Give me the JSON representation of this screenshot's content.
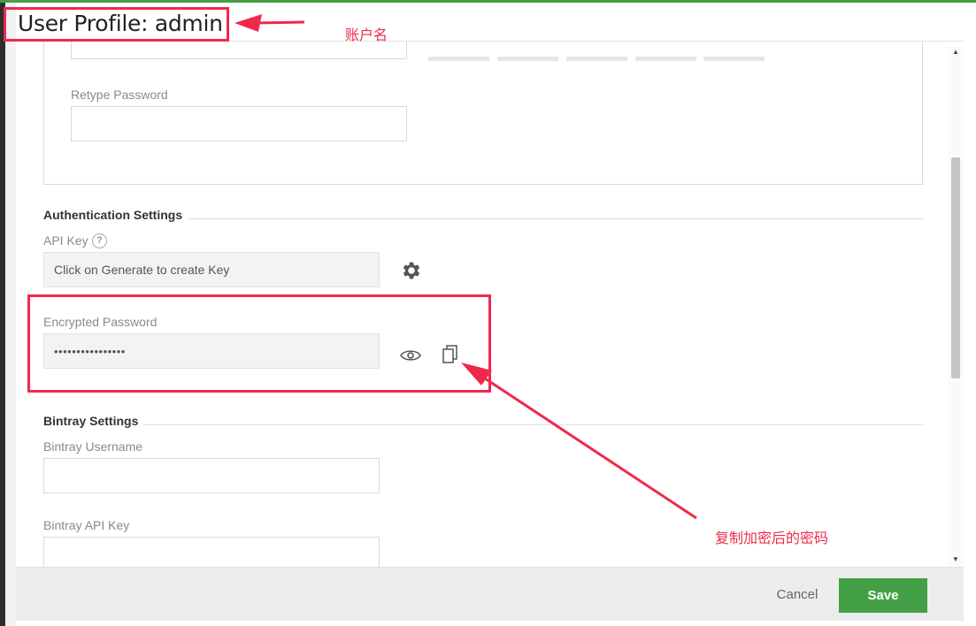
{
  "header": {
    "title": "User Profile: admin"
  },
  "password_section": {
    "retype_label": "Retype Password",
    "retype_value": ""
  },
  "auth": {
    "section_title": "Authentication Settings",
    "api_key_label": "API Key",
    "api_key_help": "?",
    "api_key_placeholder": "Click on Generate to create Key",
    "encrypted_label": "Encrypted Password",
    "encrypted_value": "••••••••••••••••"
  },
  "bintray": {
    "section_title": "Bintray Settings",
    "username_label": "Bintray Username",
    "api_key_label": "Bintray API Key"
  },
  "footer": {
    "cancel_label": "Cancel",
    "save_label": "Save"
  },
  "annotations": {
    "account_name": "账户名",
    "copy_hint": "复制加密后的密码"
  },
  "colors": {
    "accent_green": "#43a047",
    "annotation_red": "#f0284c"
  },
  "icons": {
    "generate": "gear-icon",
    "reveal": "eye-icon",
    "copy": "copy-icon",
    "help": "help-icon"
  }
}
